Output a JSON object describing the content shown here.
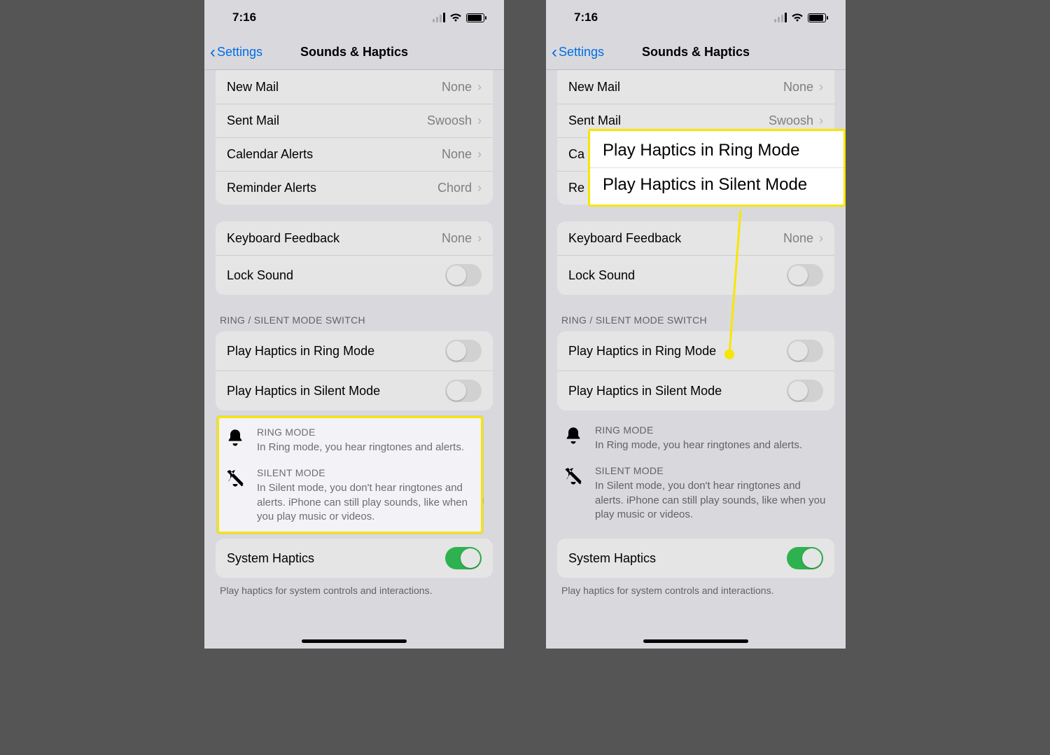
{
  "status": {
    "time": "7:16"
  },
  "nav": {
    "back": "Settings",
    "title": "Sounds & Haptics"
  },
  "rows": {
    "newMail": {
      "label": "New Mail",
      "value": "None"
    },
    "sentMail": {
      "label": "Sent Mail",
      "value": "Swoosh"
    },
    "calAlerts": {
      "label": "Calendar Alerts",
      "value": "None"
    },
    "remAlerts": {
      "label": "Reminder Alerts",
      "value": "Chord"
    },
    "kbFeedback": {
      "label": "Keyboard Feedback",
      "value": "None"
    },
    "lockSound": {
      "label": "Lock Sound"
    },
    "hapticsRing": {
      "label": "Play Haptics in Ring Mode"
    },
    "hapticsSilent": {
      "label": "Play Haptics in Silent Mode"
    },
    "systemHaptics": {
      "label": "System Haptics"
    }
  },
  "sections": {
    "ringSilent": "RING / SILENT MODE SWITCH"
  },
  "info": {
    "ring": {
      "title": "RING MODE",
      "desc": "In Ring mode, you hear ringtones and alerts."
    },
    "silent": {
      "title": "SILENT MODE",
      "desc": "In Silent mode, you don't hear ringtones and alerts. iPhone can still play sounds, like when you play music or videos."
    }
  },
  "footer": "Play haptics for system controls and interactions.",
  "callout": {
    "line1": "Play Haptics in Ring Mode",
    "line2": "Play Haptics in Silent Mode",
    "partialRow": "Ca",
    "partialRow2": "Re"
  }
}
